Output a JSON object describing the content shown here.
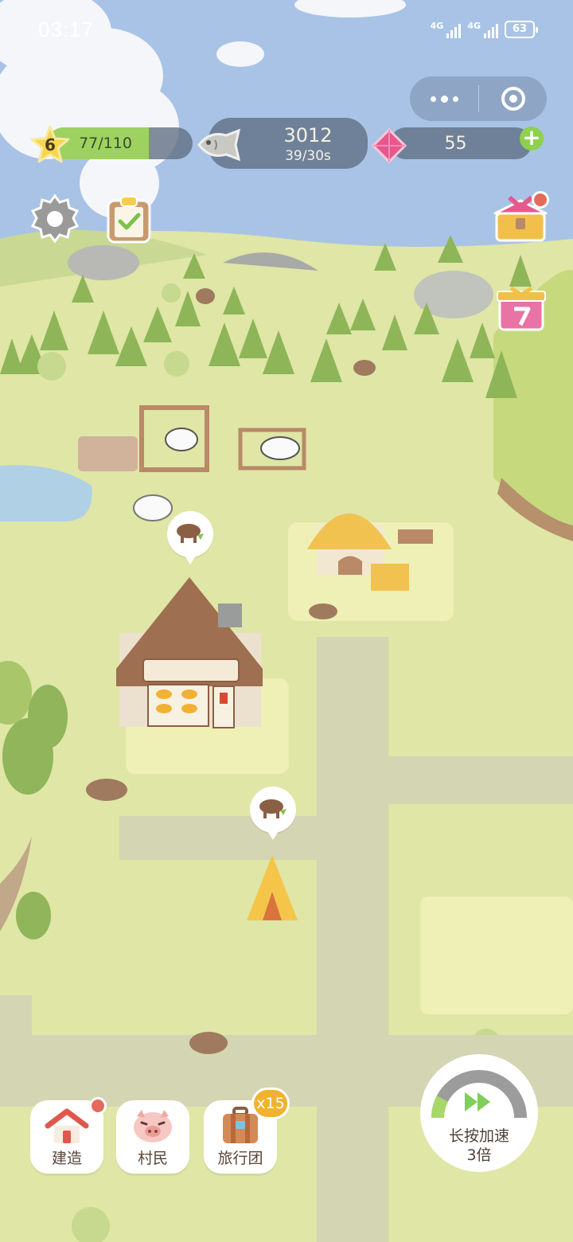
{
  "status_bar": {
    "time": "03:17",
    "signal_1_label": "4G",
    "signal_2_label": "4G",
    "battery": "63"
  },
  "resources": {
    "level": "6",
    "xp": "77/110",
    "xp_progress": 0.7,
    "fish": "3012",
    "fish_rate": "39/30s",
    "gems": "55",
    "gem_add": "+"
  },
  "hud_icons": {
    "settings": "gear-icon",
    "tasks": "clipboard-check-icon",
    "gift": "gift-chest-icon",
    "gift7": "seven-day-gift-icon"
  },
  "bottom_bar": {
    "build_label": "建造",
    "villagers_label": "村民",
    "tour_label": "旅行团",
    "tour_badge": "x15"
  },
  "speed_button": {
    "line1": "长按加速",
    "line2": "3倍"
  },
  "colors": {
    "sky": "#a9c3e6",
    "grass": "#dfe6a6",
    "accent_green": "#9dd261",
    "notification_red": "#e46a5d",
    "badge_orange": "#f1b233"
  }
}
